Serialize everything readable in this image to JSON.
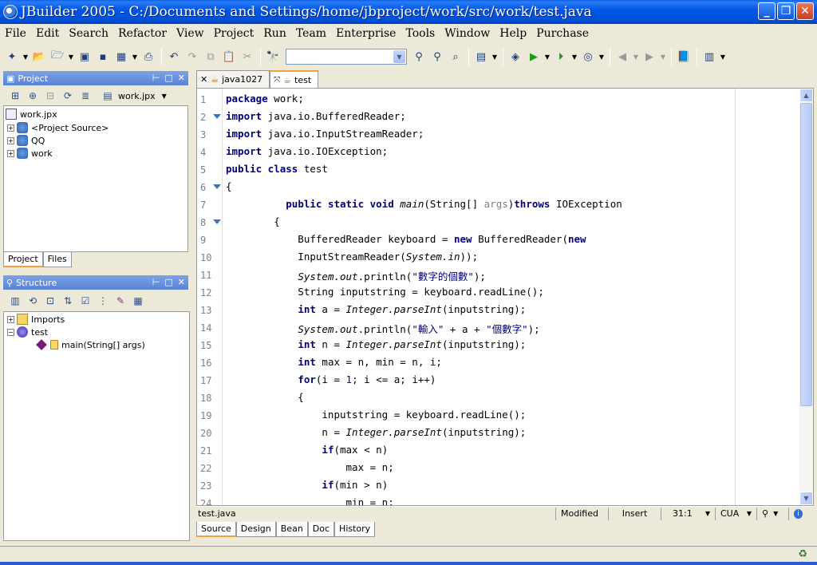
{
  "window": {
    "title": "JBuilder 2005 - C:/Documents and Settings/home/jbproject/work/src/work/test.java"
  },
  "menu": [
    "File",
    "Edit",
    "Search",
    "Refactor",
    "View",
    "Project",
    "Run",
    "Team",
    "Enterprise",
    "Tools",
    "Window",
    "Help",
    "Purchase"
  ],
  "project_panel": {
    "title": "Project",
    "project_combo": "work.jpx",
    "tree": [
      {
        "label": "work.jpx",
        "level": 0
      },
      {
        "label": "<Project Source>",
        "level": 1
      },
      {
        "label": "QQ",
        "level": 1
      },
      {
        "label": "work",
        "level": 1
      }
    ],
    "tabs": [
      "Project",
      "Files"
    ]
  },
  "structure_panel": {
    "title": "Structure",
    "tree": [
      {
        "label": "Imports",
        "level": 0
      },
      {
        "label": "test",
        "level": 0
      },
      {
        "label": "main(String[] args)",
        "level": 1
      }
    ]
  },
  "editor": {
    "tabs": [
      {
        "label": "java1027"
      },
      {
        "label": "test",
        "active": true
      }
    ],
    "lines": [
      {
        "n": "1",
        "html": "<b>package</b> work;"
      },
      {
        "n": "2",
        "fold": true,
        "html": "<b>import</b> java.io.BufferedReader;"
      },
      {
        "n": "3",
        "html": "<b>import</b> java.io.InputStreamReader;"
      },
      {
        "n": "4",
        "html": "<b>import</b> java.io.IOException;"
      },
      {
        "n": "5",
        "html": "<b>public class</b> test"
      },
      {
        "n": "6",
        "fold": true,
        "html": "{"
      },
      {
        "n": "7",
        "html": "          <b>public static void</b> <i>main</i>(String[] <span class='gry'>args</span>)<b>throws</b> IOException"
      },
      {
        "n": "8",
        "fold": true,
        "html": "        {"
      },
      {
        "n": "9",
        "html": "            BufferedReader keyboard = <b>new</b> BufferedReader(<b>new</b>"
      },
      {
        "n": "10",
        "html": "            InputStreamReader(<i>System.in</i>));"
      },
      {
        "n": "11",
        "html": "            <i>System.out</i>.println(<span class='str'>\"數字的個數\"</span>);"
      },
      {
        "n": "12",
        "html": "            String inputstring = keyboard.readLine();"
      },
      {
        "n": "13",
        "html": "            <b>int</b> a = <i>Integer.parseInt</i>(inputstring);"
      },
      {
        "n": "14",
        "html": "            <i>System.out</i>.println(<span class='str'>\"輸入\"</span> + a + <span class='str'>\"個數字\"</span>);"
      },
      {
        "n": "15",
        "html": "            <b>int</b> n = <i>Integer.parseInt</i>(inputstring);"
      },
      {
        "n": "16",
        "html": "            <b>int</b> max = n, min = n, i;"
      },
      {
        "n": "17",
        "html": "            <b>for</b>(i = <span class='num'>1</span>; i &lt;= a; i++)"
      },
      {
        "n": "18",
        "html": "            {"
      },
      {
        "n": "19",
        "html": "                inputstring = keyboard.readLine();"
      },
      {
        "n": "20",
        "html": "                n = <i>Integer.parseInt</i>(inputstring);"
      },
      {
        "n": "21",
        "html": "                <b>if</b>(max &lt; n)"
      },
      {
        "n": "22",
        "html": "                    max = n;"
      },
      {
        "n": "23",
        "html": "                <b>if</b>(min &gt; n)"
      },
      {
        "n": "24",
        "html": "                    min = n;"
      }
    ],
    "status": {
      "file": "test.java",
      "modified": "Modified",
      "mode": "Insert",
      "position": "31:1",
      "keymap": "CUA"
    },
    "bottom_tabs": [
      "Source",
      "Design",
      "Bean",
      "Doc",
      "History"
    ]
  },
  "colors": {
    "titlebar": "#0058e6",
    "panel_header": "#5a83d4",
    "keyword": "#000080",
    "active_tab_accent": "#f2a23a"
  }
}
